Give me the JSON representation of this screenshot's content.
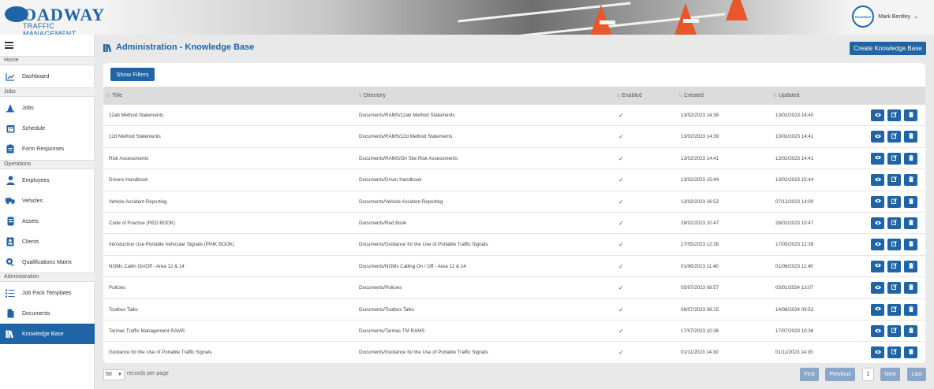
{
  "header": {
    "logo_text": "ROADWAY",
    "logo_sub": "TRAFFIC MANAGEMENT",
    "user_name": "Mark Bentley",
    "avatar_text": "ROADWAY"
  },
  "sidebar": {
    "sections": {
      "home": "Home",
      "jobs": "Jobs",
      "operations": "Operations",
      "administration": "Administration"
    },
    "items": [
      {
        "label": "Dashboard",
        "icon": "chart-line-icon"
      },
      {
        "label": "Jobs",
        "icon": "cone-icon"
      },
      {
        "label": "Schedule",
        "icon": "calendar-icon"
      },
      {
        "label": "Form Responses",
        "icon": "clipboard-icon"
      },
      {
        "label": "Employees",
        "icon": "user-icon"
      },
      {
        "label": "Vehicles",
        "icon": "truck-icon"
      },
      {
        "label": "Assets",
        "icon": "barrier-icon"
      },
      {
        "label": "Clients",
        "icon": "id-card-icon"
      },
      {
        "label": "Qualifications Matrix",
        "icon": "certificate-icon"
      },
      {
        "label": "Job Pack Templates",
        "icon": "list-icon"
      },
      {
        "label": "Documents",
        "icon": "file-icon"
      },
      {
        "label": "Knowledge Base",
        "icon": "books-icon",
        "active": true
      }
    ]
  },
  "page": {
    "title": "Administration - Knowledge Base",
    "create_button": "Create Knowledge Base",
    "filters_button": "Show Filters"
  },
  "table": {
    "columns": [
      "Title",
      "Directory",
      "Enabled",
      "Created",
      "Updated"
    ],
    "rows": [
      {
        "title": "12ab Method Statements",
        "directory": "Documents/RAMS/12ab Method Statements",
        "enabled": "✓",
        "created": "13/02/2023 14:38",
        "updated": "13/02/2023 14:40"
      },
      {
        "title": "12d Method Statements",
        "directory": "Documents/RAMS/12d Method Statements",
        "enabled": "✓",
        "created": "13/02/2023 14:39",
        "updated": "13/02/2023 14:41"
      },
      {
        "title": "Risk Assessments",
        "directory": "Documents/RAMS/On Site Risk Assessments",
        "enabled": "✓",
        "created": "13/02/2023 14:41",
        "updated": "13/02/2023 14:41"
      },
      {
        "title": "Drivers Handbook",
        "directory": "Documents/Driver Handbook",
        "enabled": "✓",
        "created": "13/02/2023 15:44",
        "updated": "13/02/2023 15:44"
      },
      {
        "title": "Vehicle Accident Reporting",
        "directory": "Documents/Vehicle Accident Reporting",
        "enabled": "✓",
        "created": "13/02/2023 16:53",
        "updated": "07/12/2023 14:00"
      },
      {
        "title": "Code of Practice (RED BOOK)",
        "directory": "Documents/Red Book",
        "enabled": "✓",
        "created": "28/02/2023 10:47",
        "updated": "28/02/2023 10:47"
      },
      {
        "title": "Introduction Use Portable Vehicular Signals (PINK BOOK)",
        "directory": "Documents/Guidance for the Use of Portable Traffic Signals",
        "enabled": "✓",
        "created": "17/05/2023 12:38",
        "updated": "17/05/2023 12:38"
      },
      {
        "title": "NOMs Callin On/Off - Area 12 & 14",
        "directory": "Documents/NOMs Calling On / Off - Area 12 & 14",
        "enabled": "✓",
        "created": "01/06/2023 11:40",
        "updated": "01/06/2023 11:40"
      },
      {
        "title": "Policies",
        "directory": "Documents/Policies",
        "enabled": "✓",
        "created": "05/07/2023 08:57",
        "updated": "03/01/2024 13:07"
      },
      {
        "title": "Toolbox Talks",
        "directory": "Documents/Toolbox Talks",
        "enabled": "✓",
        "created": "06/07/2023 08:15",
        "updated": "14/06/2024 09:52"
      },
      {
        "title": "Tarmac Traffic Management RAMS",
        "directory": "Documents/Tarmac TM RAMS",
        "enabled": "✓",
        "created": "17/07/2023 10:36",
        "updated": "17/07/2023 10:36"
      },
      {
        "title": "Guidance for the Use of Portable Traffic Signals",
        "directory": "Documents/Guidance for the Use of Portable Traffic Signals",
        "enabled": "✓",
        "created": "01/11/2023 14:30",
        "updated": "01/11/2023 14:30"
      }
    ]
  },
  "footer": {
    "page_size": "50",
    "records_per_page": "records per page",
    "first": "First",
    "previous": "Previous",
    "current_page": "1",
    "next": "Next",
    "last": "Last"
  },
  "colors": {
    "primary": "#1f64a6",
    "pager_disabled": "#8aa6c8",
    "header_row": "#dcdcdc"
  }
}
